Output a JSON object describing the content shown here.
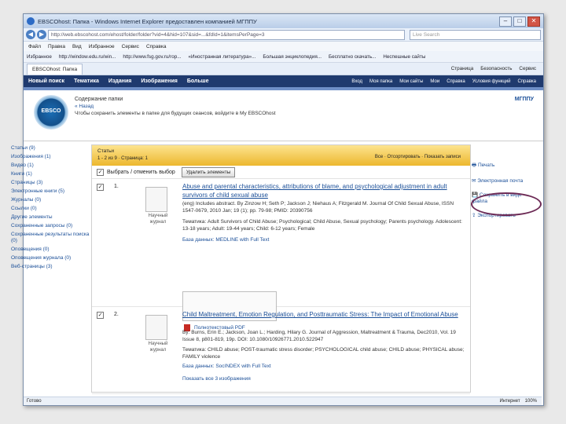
{
  "window": {
    "title": "EBSCOhost: Папка - Windows Internet Explorer предоставлен компанией МГППУ"
  },
  "addressbar": {
    "url": "http://web.ebscohost.com/ehost/folder/folder?vid=4&hid=107&sid=...&fdId=1&itemsPerPage=3",
    "search_placeholder": "Live Search"
  },
  "menu": [
    "Файл",
    "Правка",
    "Вид",
    "Избранное",
    "Сервис",
    "Справка"
  ],
  "favorites": [
    "Избранное",
    "http://window.edu.ru/win...",
    "http://www.fsg.gov.ru/гор...",
    "«Иностранная литература»...",
    "Большая энциклопедия...",
    "Бесплатно скачать...",
    "Неспешные сайты"
  ],
  "tab": {
    "label": "EBSCOhost: Папка"
  },
  "tools": [
    "Страница",
    "Безопасность",
    "Сервис"
  ],
  "ebsco_nav": {
    "left": [
      "Новый поиск",
      "Тематика",
      "Издания",
      "Изображения",
      "Больше"
    ],
    "right": [
      "Вход",
      "Моя папка",
      "Мои сайты",
      "Мои",
      "Справка",
      "Условия функций",
      "Справка"
    ]
  },
  "header": {
    "title": "Содержание папки",
    "subtitle": "« Назад",
    "line": "Чтобы сохранить элементы в папке для будущих сеансов, войдите в My EBSCOhost",
    "brand": "МГППУ",
    "logo": "EBSCO"
  },
  "leftpanel": [
    "Статьи (9)",
    "Изображения (1)",
    "Видео (1)",
    "Книги (1)",
    "Страницы (3)",
    "Электронные книги (5)",
    "Журналы (0)",
    "Ссылки (0)",
    "Другие элементы",
    "Сохраненные запросы (0)",
    "Сохраненные результаты поиска (0)",
    "Оповещения (0)",
    "Оповещения журнала (0)",
    "Веб-страницы (3)"
  ],
  "folder": {
    "title": "Статьи",
    "subtitle": "1 - 2 из 9 · Страница: 1",
    "controls": "Все · Отсортировать · Показать записи"
  },
  "select_bar": {
    "label": "Выбрать / отменить выбор",
    "delete_button": "Удалить элементы"
  },
  "records": [
    {
      "num": "1.",
      "title": "Abuse and parental characteristics, attributions of blame, and psychological adjustment in adult survivors of child sexual abuse",
      "meta": "(eng) Includes abstract. By Zinzow H; Seth P; Jackson J; Niehaus A; Fitzgerald M. Journal Of Child Sexual Abuse, ISSN 1547-0679, 2010 Jan; 19 (1); pp. 79-98; PMID: 20390756",
      "subjects": "Тематика: Adult Survivors of Child Abuse; Psychological; Child Abuse, Sexual psychology; Parents psychology. Adolescent: 13-18 years; Adult: 19-44 years; Child: 6-12 years; Female",
      "db": "База данных: MEDLINE with Full Text",
      "pdf": "Полнотекстовый PDF",
      "thumb_label": "Научный журнал"
    },
    {
      "num": "2.",
      "title": "Child Maltreatment, Emotion Regulation, and Posttraumatic Stress: The Impact of Emotional Abuse",
      "meta": "By: Burns, Erin E.; Jackson, Joan L.; Harding, Hilary G. Journal of Aggression, Maltreatment & Trauma, Dec2010, Vol. 19 Issue 8, p801-819, 19p. DOI: 10.1080/10926771.2010.522947",
      "subjects": "Тематика: CHILD abuse; POST-traumatic stress disorder; PSYCHOLOGICAL child abuse; CHILD abuse; PHYSICAL abuse; FAMILY violence",
      "db": "База данных: SocINDEX with Full Text",
      "extra": "Показать все 3 изображения",
      "thumb_label": "Научный журнал"
    }
  ],
  "rightpanel": [
    "Печать",
    "Электронная почта",
    "Сохранить в виде файла",
    "Экспортировать"
  ],
  "status": {
    "left": "Готово",
    "zone": "Интернет",
    "zoom": "100%"
  }
}
